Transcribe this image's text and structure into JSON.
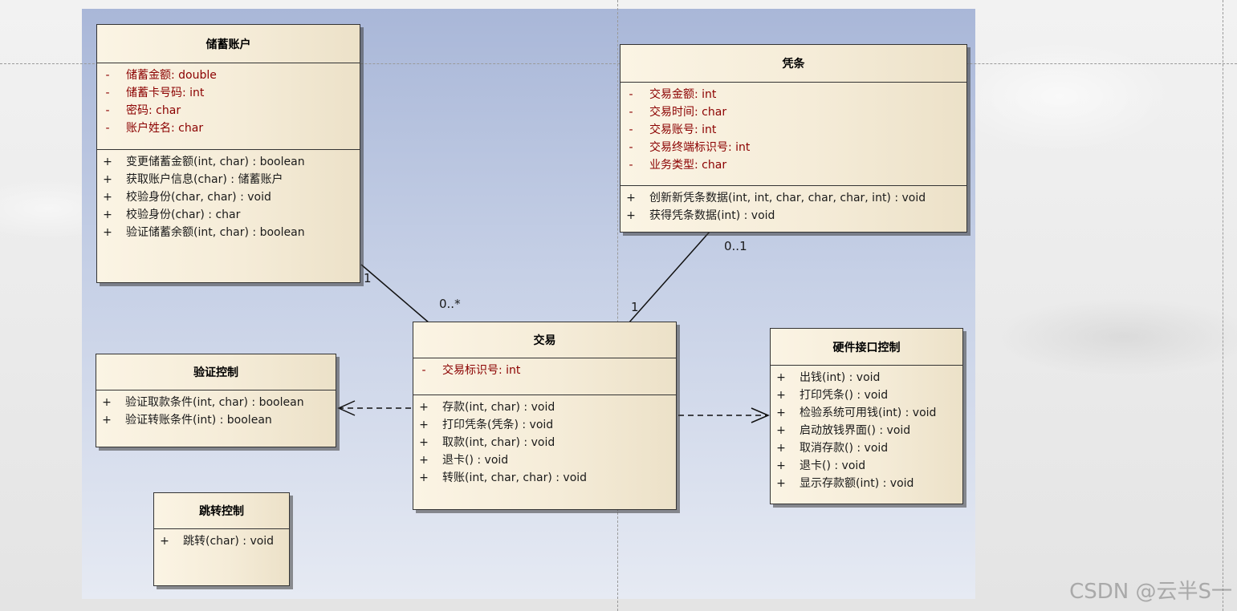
{
  "classes": {
    "savings": {
      "name": "储蓄账户",
      "attributes": [
        {
          "vis": "-",
          "text": "储蓄金额: double"
        },
        {
          "vis": "-",
          "text": "储蓄卡号码: int"
        },
        {
          "vis": "-",
          "text": "密码: char"
        },
        {
          "vis": "-",
          "text": "账户姓名: char"
        }
      ],
      "operations": [
        {
          "vis": "+",
          "text": "变更储蓄金额(int, char) : boolean"
        },
        {
          "vis": "+",
          "text": "获取账户信息(char) : 储蓄账户"
        },
        {
          "vis": "+",
          "text": "校验身份(char, char) : void"
        },
        {
          "vis": "+",
          "text": "校验身份(char) : char"
        },
        {
          "vis": "+",
          "text": "验证储蓄余额(int, char) : boolean"
        }
      ]
    },
    "voucher": {
      "name": "凭条",
      "attributes": [
        {
          "vis": "-",
          "text": "交易金额: int"
        },
        {
          "vis": "-",
          "text": "交易时间: char"
        },
        {
          "vis": "-",
          "text": "交易账号: int"
        },
        {
          "vis": "-",
          "text": "交易终端标识号: int"
        },
        {
          "vis": "-",
          "text": "业务类型: char"
        }
      ],
      "operations": [
        {
          "vis": "+",
          "text": "创新新凭条数据(int, int, char, char, char, int) : void"
        },
        {
          "vis": "+",
          "text": "获得凭条数据(int) : void"
        }
      ]
    },
    "transaction": {
      "name": "交易",
      "attributes": [
        {
          "vis": "-",
          "text": "交易标识号: int"
        }
      ],
      "operations": [
        {
          "vis": "+",
          "text": "存款(int, char) : void"
        },
        {
          "vis": "+",
          "text": "打印凭条(凭条) : void"
        },
        {
          "vis": "+",
          "text": "取款(int, char) : void"
        },
        {
          "vis": "+",
          "text": "退卡() : void"
        },
        {
          "vis": "+",
          "text": "转账(int, char, char) : void"
        }
      ]
    },
    "verify": {
      "name": "验证控制",
      "operations": [
        {
          "vis": "+",
          "text": "验证取款条件(int, char) : boolean"
        },
        {
          "vis": "+",
          "text": "验证转账条件(int) : boolean"
        }
      ]
    },
    "hardware": {
      "name": "硬件接口控制",
      "operations": [
        {
          "vis": "+",
          "text": "出钱(int) : void"
        },
        {
          "vis": "+",
          "text": "打印凭条() : void"
        },
        {
          "vis": "+",
          "text": "检验系统可用钱(int) : void"
        },
        {
          "vis": "+",
          "text": "启动放钱界面() : void"
        },
        {
          "vis": "+",
          "text": "取消存款() : void"
        },
        {
          "vis": "+",
          "text": "退卡() : void"
        },
        {
          "vis": "+",
          "text": "显示存款额(int) : void"
        }
      ]
    },
    "jump": {
      "name": "跳转控制",
      "operations": [
        {
          "vis": "+",
          "text": "跳转(char) : void"
        }
      ]
    }
  },
  "multiplicities": {
    "savings_end": "1",
    "transaction_savings_end": "0..*",
    "transaction_voucher_end": "1",
    "voucher_end": "0..1"
  },
  "watermark": "CSDN @云半S一"
}
